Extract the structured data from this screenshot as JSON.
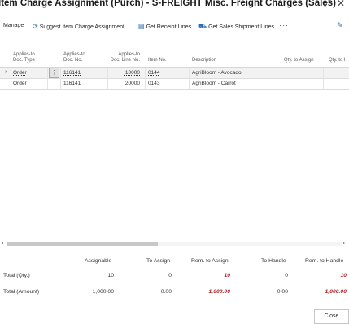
{
  "window": {
    "title": "Item Charge Assignment (Purch) - S-FREIGHT Misc. Freight Charges (Sales)",
    "expand_icon": "expand-icon",
    "close_icon": "close-icon"
  },
  "actions": [
    {
      "label": "Manage",
      "icon": ""
    },
    {
      "label": "Suggest Item Charge Assignment...",
      "icon": "suggest-icon"
    },
    {
      "label": "Get Receipt Lines",
      "icon": "receipt-icon"
    },
    {
      "label": "Get Sales Shipment Lines",
      "icon": "shipment-icon"
    }
  ],
  "more_actions": "···",
  "grid": {
    "headers": {
      "doc_type": [
        "Applies-to",
        "Doc. Type"
      ],
      "doc_no": [
        "Applies-to",
        "Doc. No."
      ],
      "doc_line_no": [
        "Applies-to",
        "Doc. Line No."
      ],
      "item_no": "Item No.",
      "description": "Description",
      "qty_to_assign": "Qty. to Assign",
      "qty_to_handle": "Qty. to H"
    },
    "rows": [
      {
        "doc_type": "Order",
        "doc_no": "116141",
        "doc_line_no": "10000",
        "item_no": "0144",
        "description": "AgriBloom - Avocado",
        "selected": true
      },
      {
        "doc_type": "Order",
        "doc_no": "116141",
        "doc_line_no": "20000",
        "item_no": "0143",
        "description": "AgriBloom - Carrot",
        "selected": false
      }
    ]
  },
  "totals": {
    "headers": {
      "assignable": "Assignable",
      "to_assign": "To Assign",
      "rem_to_assign": "Rem. to Assign",
      "to_handle": "To Handle",
      "rem_to_handle": "Rem. to Handle"
    },
    "qty": {
      "label": "Total (Qty.)",
      "assignable": "10",
      "to_assign": "0",
      "rem_to_assign": "10",
      "to_handle": "0",
      "rem_to_handle": "10"
    },
    "amount": {
      "label": "Total (Amount)",
      "assignable": "1,000.00",
      "to_assign": "0.00",
      "rem_to_assign": "1,000.00",
      "to_handle": "0.00",
      "rem_to_handle": "1,000.00"
    }
  },
  "footer": {
    "close_label": "Close"
  }
}
